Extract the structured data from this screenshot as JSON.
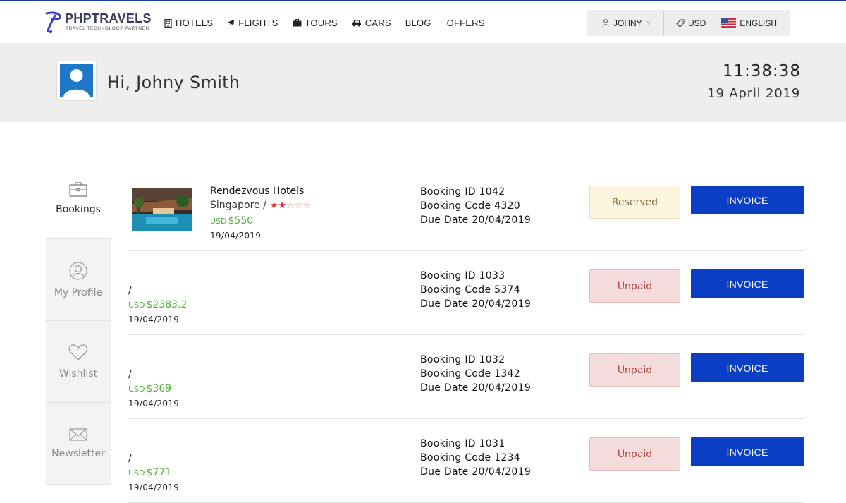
{
  "brand": {
    "title": "PHPTRAVELS",
    "subtitle": "TRAVEL TECHNOLOGY PARTNER",
    "color": "#3b3b5c",
    "accent": "#1a3ca8"
  },
  "nav": {
    "items": [
      {
        "label": "HOTELS",
        "icon": "building-icon"
      },
      {
        "label": "FLIGHTS",
        "icon": "plane-icon"
      },
      {
        "label": "TOURS",
        "icon": "suitcase-icon"
      },
      {
        "label": "CARS",
        "icon": "car-icon"
      },
      {
        "label": "BLOG",
        "icon": ""
      },
      {
        "label": "OFFERS",
        "icon": ""
      }
    ]
  },
  "account": {
    "user": "JOHNY",
    "currency": "USD",
    "language": "ENGLISH"
  },
  "greeting": {
    "text": "Hi, Johny Smith",
    "time": "11:38:38",
    "date": "19 April 2019"
  },
  "sidebar": {
    "tabs": [
      {
        "label": "Bookings",
        "icon": "briefcase-icon",
        "active": true
      },
      {
        "label": "My Profile",
        "icon": "user-icon",
        "active": false
      },
      {
        "label": "Wishlist",
        "icon": "heart-icon",
        "active": false
      },
      {
        "label": "Newsletter",
        "icon": "envelope-icon",
        "active": false
      }
    ]
  },
  "bookings": [
    {
      "hotel": "Rendezvous Hotels",
      "location": "Singapore /",
      "stars": 2,
      "stars_max": 5,
      "currency": "USD",
      "price": "$550",
      "date": "19/04/2019",
      "booking_id": "Booking ID 1042",
      "booking_code": "Booking Code 4320",
      "due_date": "Due Date 20/04/2019",
      "status": "Reserved",
      "invoice_label": "INVOICE"
    },
    {
      "location": "/",
      "currency": "USD",
      "price": "$2383.2",
      "date": "19/04/2019",
      "booking_id": "Booking ID 1033",
      "booking_code": "Booking Code 5374",
      "due_date": "Due Date 20/04/2019",
      "status": "Unpaid",
      "invoice_label": "INVOICE"
    },
    {
      "location": "/",
      "currency": "USD",
      "price": "$369",
      "date": "19/04/2019",
      "booking_id": "Booking ID 1032",
      "booking_code": "Booking Code 1342",
      "due_date": "Due Date 20/04/2019",
      "status": "Unpaid",
      "invoice_label": "INVOICE"
    },
    {
      "location": "/",
      "currency": "USD",
      "price": "$771",
      "date": "19/04/2019",
      "booking_id": "Booking ID 1031",
      "booking_code": "Booking Code 1234",
      "due_date": "Due Date 20/04/2019",
      "status": "Unpaid",
      "invoice_label": "INVOICE"
    }
  ],
  "colors": {
    "invoice": "#0a3ec4",
    "price": "#52b13c",
    "reserved_bg": "#fcf6e0",
    "unpaid_bg": "#f5dcdc"
  }
}
